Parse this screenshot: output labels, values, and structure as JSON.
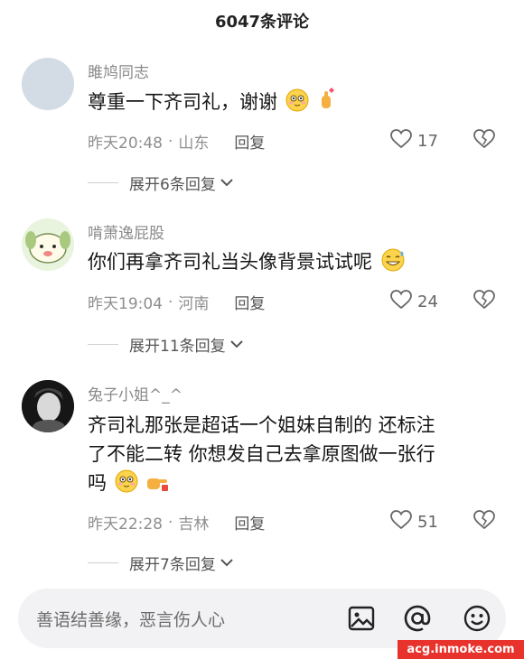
{
  "header": {
    "title": "6047条评论"
  },
  "comments": [
    {
      "username": "雎鸠同志",
      "text": "尊重一下齐司礼，谢谢",
      "emojis": [
        "blush-face-emoji",
        "finger-heart-emoji"
      ],
      "date": "昨天20:48",
      "separator": "·",
      "location": "山东",
      "reply": "回复",
      "likes": "17",
      "expand": "展开6条回复"
    },
    {
      "username": "啃萧逸屁股",
      "text": "你们再拿齐司礼当头像背景试试呢",
      "emojis": [
        "sweat-smile-emoji"
      ],
      "date": "昨天19:04",
      "separator": "·",
      "location": "河南",
      "reply": "回复",
      "likes": "24",
      "expand": "展开11条回复"
    },
    {
      "username": "兔子小姐^_^",
      "text_line1": "齐司礼那张是超话一个姐妹自制的 还标注",
      "text_line2": "了不能二转 你想发自己去拿原图做一张行",
      "text_line3": "吗",
      "emojis": [
        "blush-face-emoji",
        "pointing-hand-emoji"
      ],
      "date": "昨天22:28",
      "separator": "·",
      "location": "吉林",
      "reply": "回复",
      "likes": "51",
      "expand": "展开7条回复"
    }
  ],
  "input": {
    "placeholder": "善语结善缘，恶言伤人心"
  },
  "icons": [
    "image-icon",
    "at-icon",
    "emoji-icon",
    "heart-outline-icon",
    "dislike-heart-icon",
    "chevron-down-icon"
  ],
  "watermark": "acg.inmoke.com",
  "colors": {
    "muted": "#8e8e8e",
    "input_bg": "#f2f2f4",
    "watermark_bg": "#e8322c"
  }
}
